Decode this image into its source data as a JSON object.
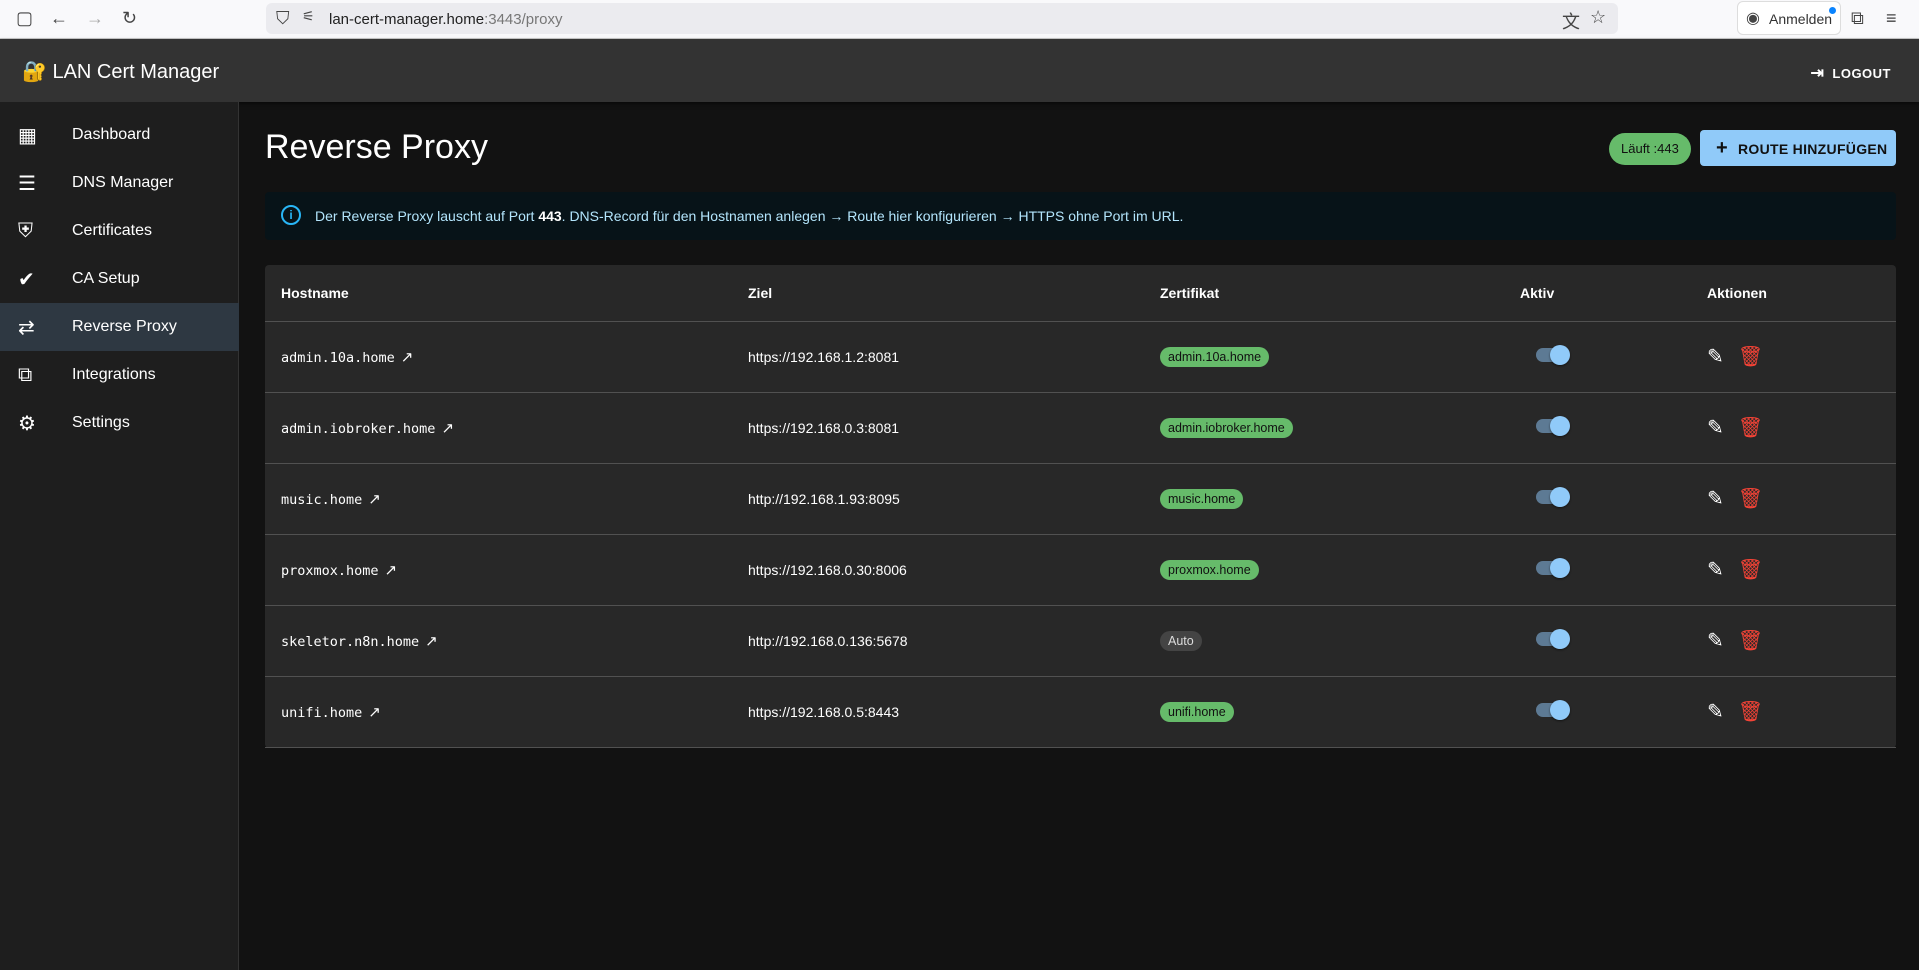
{
  "browser": {
    "url_host": "lan-cert-manager.home",
    "url_rest": ":3443/proxy",
    "signin": "Anmelden"
  },
  "app": {
    "title": "🔐 LAN Cert Manager",
    "logout": "LOGOUT"
  },
  "sidebar": {
    "items": [
      {
        "label": "Dashboard",
        "icon": "▦"
      },
      {
        "label": "DNS Manager",
        "icon": "☰"
      },
      {
        "label": "Certificates",
        "icon": "⛨"
      },
      {
        "label": "CA Setup",
        "icon": "✔"
      },
      {
        "label": "Reverse Proxy",
        "icon": "⇄"
      },
      {
        "label": "Integrations",
        "icon": "⧉"
      },
      {
        "label": "Settings",
        "icon": "⚙"
      }
    ]
  },
  "page": {
    "title": "Reverse Proxy",
    "status": "Läuft :443",
    "add_button": "ROUTE HINZUFÜGEN",
    "info_pre": "Der Reverse Proxy lauscht auf Port ",
    "info_port": "443",
    "info_post": ". DNS-Record für den Hostnamen anlegen → Route hier konfigurieren → HTTPS ohne Port im URL."
  },
  "table": {
    "headers": [
      "Hostname",
      "Ziel",
      "Zertifikat",
      "Aktiv",
      "Aktionen"
    ],
    "rows": [
      {
        "host": "admin.10a.home",
        "target": "https://192.168.1.2:8081",
        "cert": "admin.10a.home",
        "active": true
      },
      {
        "host": "admin.iobroker.home",
        "target": "https://192.168.0.3:8081",
        "cert": "admin.iobroker.home",
        "active": true
      },
      {
        "host": "music.home",
        "target": "http://192.168.1.93:8095",
        "cert": "music.home",
        "active": true
      },
      {
        "host": "proxmox.home",
        "target": "https://192.168.0.30:8006",
        "cert": "proxmox.home",
        "active": true
      },
      {
        "host": "skeletor.n8n.home",
        "target": "http://192.168.0.136:5678",
        "cert": "Auto",
        "active": true
      },
      {
        "host": "unifi.home",
        "target": "https://192.168.0.5:8443",
        "cert": "unifi.home",
        "active": true
      }
    ]
  }
}
